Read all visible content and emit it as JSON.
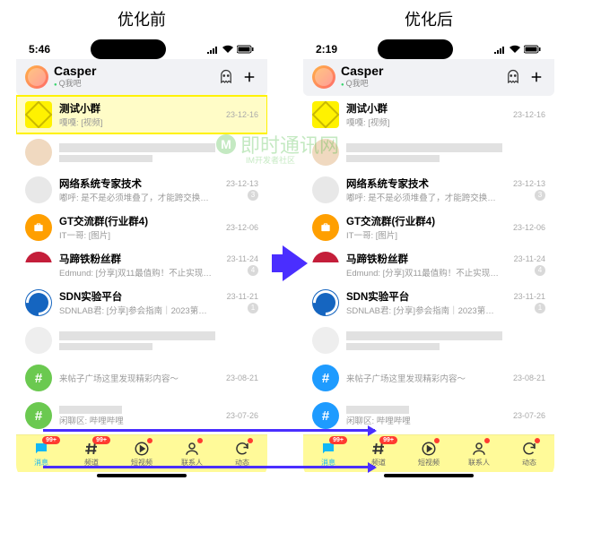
{
  "labels": {
    "before": "优化前",
    "after": "优化后"
  },
  "left": {
    "time": "5:46",
    "header": {
      "title": "Casper",
      "subtitle": "Q我吧"
    }
  },
  "right": {
    "time": "2:19",
    "header": {
      "title": "Casper",
      "subtitle": "Q我吧"
    }
  },
  "chats": [
    {
      "name": "测试小群",
      "msg": "嘎嘎: [视频]",
      "date": "23-12-16",
      "avatar": "yellow-cube",
      "hl_left": true,
      "badge": ""
    },
    {
      "name": "",
      "msg": "",
      "date": "",
      "avatar": "photo",
      "blur": true
    },
    {
      "name": "网络系统专家技术",
      "msg": "嘟呼: 是不是必须堆叠了，才能跨交换机…",
      "date": "23-12-13",
      "avatar": "grp",
      "badge": "3"
    },
    {
      "name": "GT交流群(行业群4)",
      "msg": "IT一哥: [图片]",
      "date": "23-12-06",
      "avatar": "orange",
      "badge": ""
    },
    {
      "name": "马蹄铁粉丝群",
      "msg": "Edmund: [分享]双11最值购！不止实现喝…",
      "date": "23-11-24",
      "avatar": "red",
      "badge": "4"
    },
    {
      "name": "SDN实验平台",
      "msg": "SDNLAB君: [分享]参会指南｜2023第六届…",
      "date": "23-11-21",
      "avatar": "blue-swirl",
      "badge": "1"
    },
    {
      "name": "",
      "msg": "",
      "date": "",
      "avatar": "grid2",
      "blur": true
    },
    {
      "name": "",
      "msg": "来帖子广场这里发现精彩内容～",
      "date": "23-08-21",
      "avatar": "hash",
      "hash_diff": true
    },
    {
      "name": "",
      "msg": "闲聊区: 哔哩哔哩",
      "date": "23-07-26",
      "avatar": "hash",
      "hash_diff": true,
      "blur_name": true
    }
  ],
  "tabs": [
    {
      "label": "消息",
      "icon": "chat",
      "badge99": true,
      "active": true
    },
    {
      "label": "频道",
      "icon": "hash",
      "badge99": true
    },
    {
      "label": "短视频",
      "icon": "play",
      "dot": true
    },
    {
      "label": "联系人",
      "icon": "person",
      "dot": true
    },
    {
      "label": "动态",
      "icon": "refresh",
      "dot": true
    }
  ],
  "badge99_text": "99+",
  "watermark": "即时通讯网",
  "watermark_sub": "IM开发者社区"
}
